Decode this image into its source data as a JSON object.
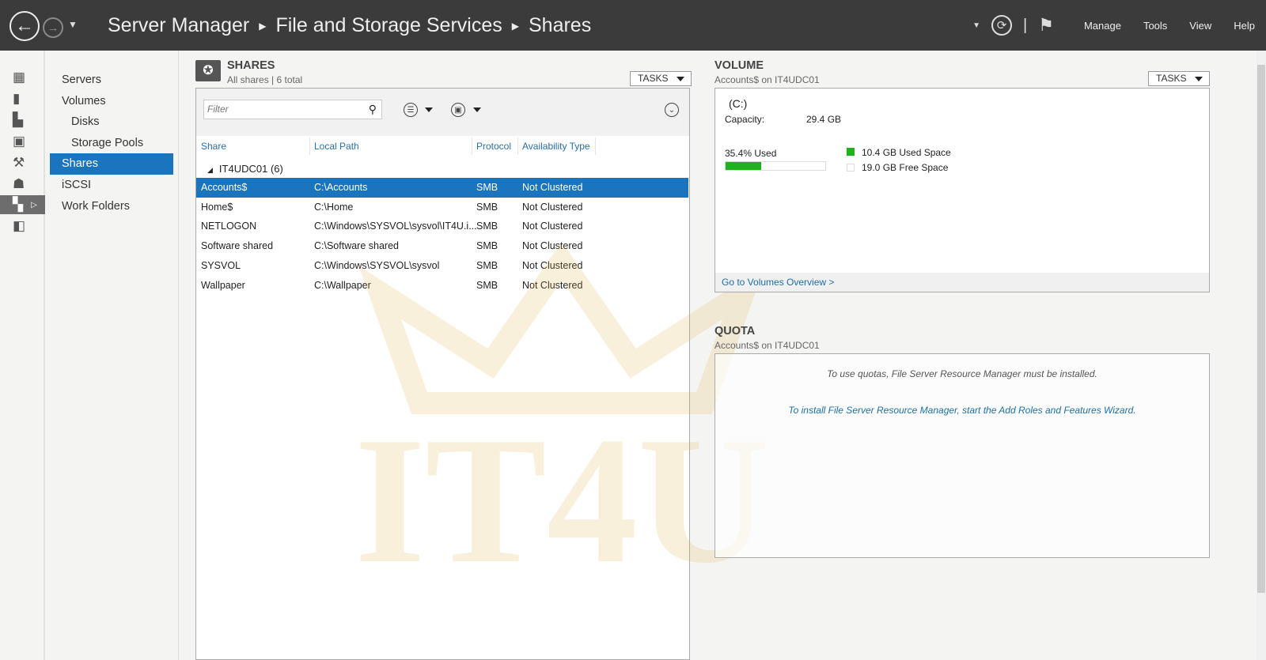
{
  "header": {
    "breadcrumb": [
      "Server Manager",
      "File and Storage Services",
      "Shares"
    ],
    "menu": [
      "Manage",
      "Tools",
      "View",
      "Help"
    ]
  },
  "subnav": {
    "items": [
      "Servers",
      "Volumes",
      "Disks",
      "Storage Pools",
      "Shares",
      "iSCSI",
      "Work Folders"
    ]
  },
  "shares": {
    "title": "SHARES",
    "subtitle": "All shares | 6 total",
    "tasks_label": "TASKS",
    "filter_placeholder": "Filter",
    "columns": [
      "Share",
      "Local Path",
      "Protocol",
      "Availability Type"
    ],
    "group": "IT4UDC01 (6)",
    "rows": [
      [
        "Accounts$",
        "C:\\Accounts",
        "SMB",
        "Not Clustered"
      ],
      [
        "Home$",
        "C:\\Home",
        "SMB",
        "Not Clustered"
      ],
      [
        "NETLOGON",
        "C:\\Windows\\SYSVOL\\sysvol\\IT4U.i...",
        "SMB",
        "Not Clustered"
      ],
      [
        "Software shared",
        "C:\\Software shared",
        "SMB",
        "Not Clustered"
      ],
      [
        "SYSVOL",
        "C:\\Windows\\SYSVOL\\sysvol",
        "SMB",
        "Not Clustered"
      ],
      [
        "Wallpaper",
        "C:\\Wallpaper",
        "SMB",
        "Not Clustered"
      ]
    ]
  },
  "volume": {
    "title": "VOLUME",
    "subtitle": "Accounts$ on IT4UDC01",
    "tasks_label": "TASKS",
    "drive": "(C:)",
    "capacity_label": "Capacity:",
    "capacity": "29.4 GB",
    "used_label": "35.4% Used",
    "used_percent": 35.4,
    "used_space": "10.4 GB Used Space",
    "free_space": "19.0 GB Free Space",
    "used_color": "#1eb31e",
    "link": "Go to Volumes Overview >"
  },
  "quota": {
    "title": "QUOTA",
    "subtitle": "Accounts$ on IT4UDC01",
    "message": "To use quotas, File Server Resource Manager must be installed.",
    "link": "To install File Server Resource Manager, start the Add Roles and Features Wizard."
  },
  "watermark": "IT4U"
}
